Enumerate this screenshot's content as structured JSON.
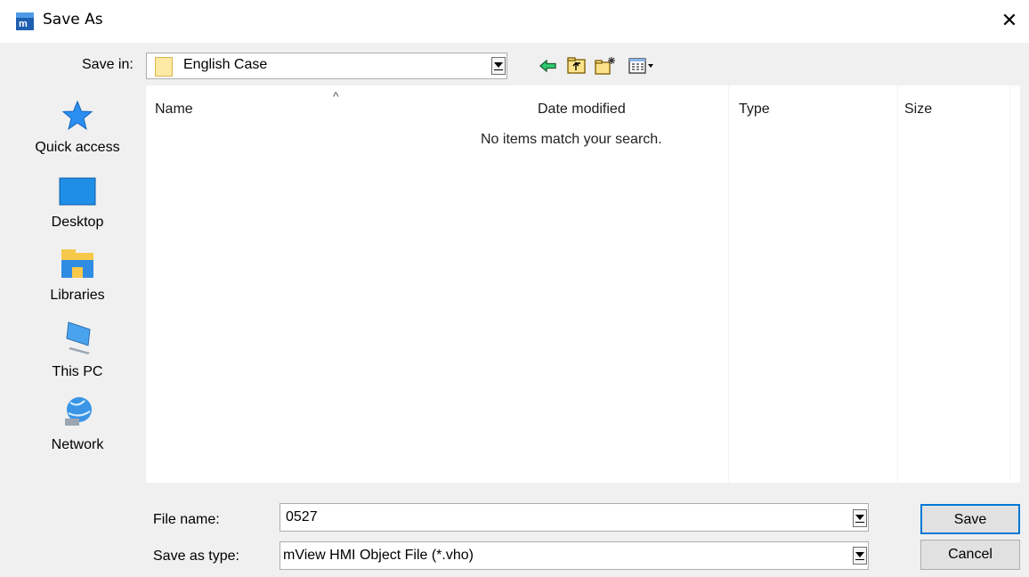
{
  "window": {
    "title": "Save As"
  },
  "save_in": {
    "label": "Save in:",
    "value": "English Case"
  },
  "places": [
    {
      "label": "Quick access",
      "icon": "quick-access-star-icon"
    },
    {
      "label": "Desktop",
      "icon": "desktop-icon"
    },
    {
      "label": "Libraries",
      "icon": "libraries-icon"
    },
    {
      "label": "This PC",
      "icon": "this-pc-icon"
    },
    {
      "label": "Network",
      "icon": "network-icon"
    }
  ],
  "columns": {
    "name": "Name",
    "date": "Date modified",
    "type": "Type",
    "size": "Size"
  },
  "empty_message": "No items match your search.",
  "file_name": {
    "label": "File name:",
    "value": "0527"
  },
  "save_as_type": {
    "label": "Save as type:",
    "value": "mView HMI Object File (*.vho)"
  },
  "buttons": {
    "save": "Save",
    "cancel": "Cancel"
  },
  "colors": {
    "accent": "#0078d7",
    "star": "#1e90ff"
  }
}
